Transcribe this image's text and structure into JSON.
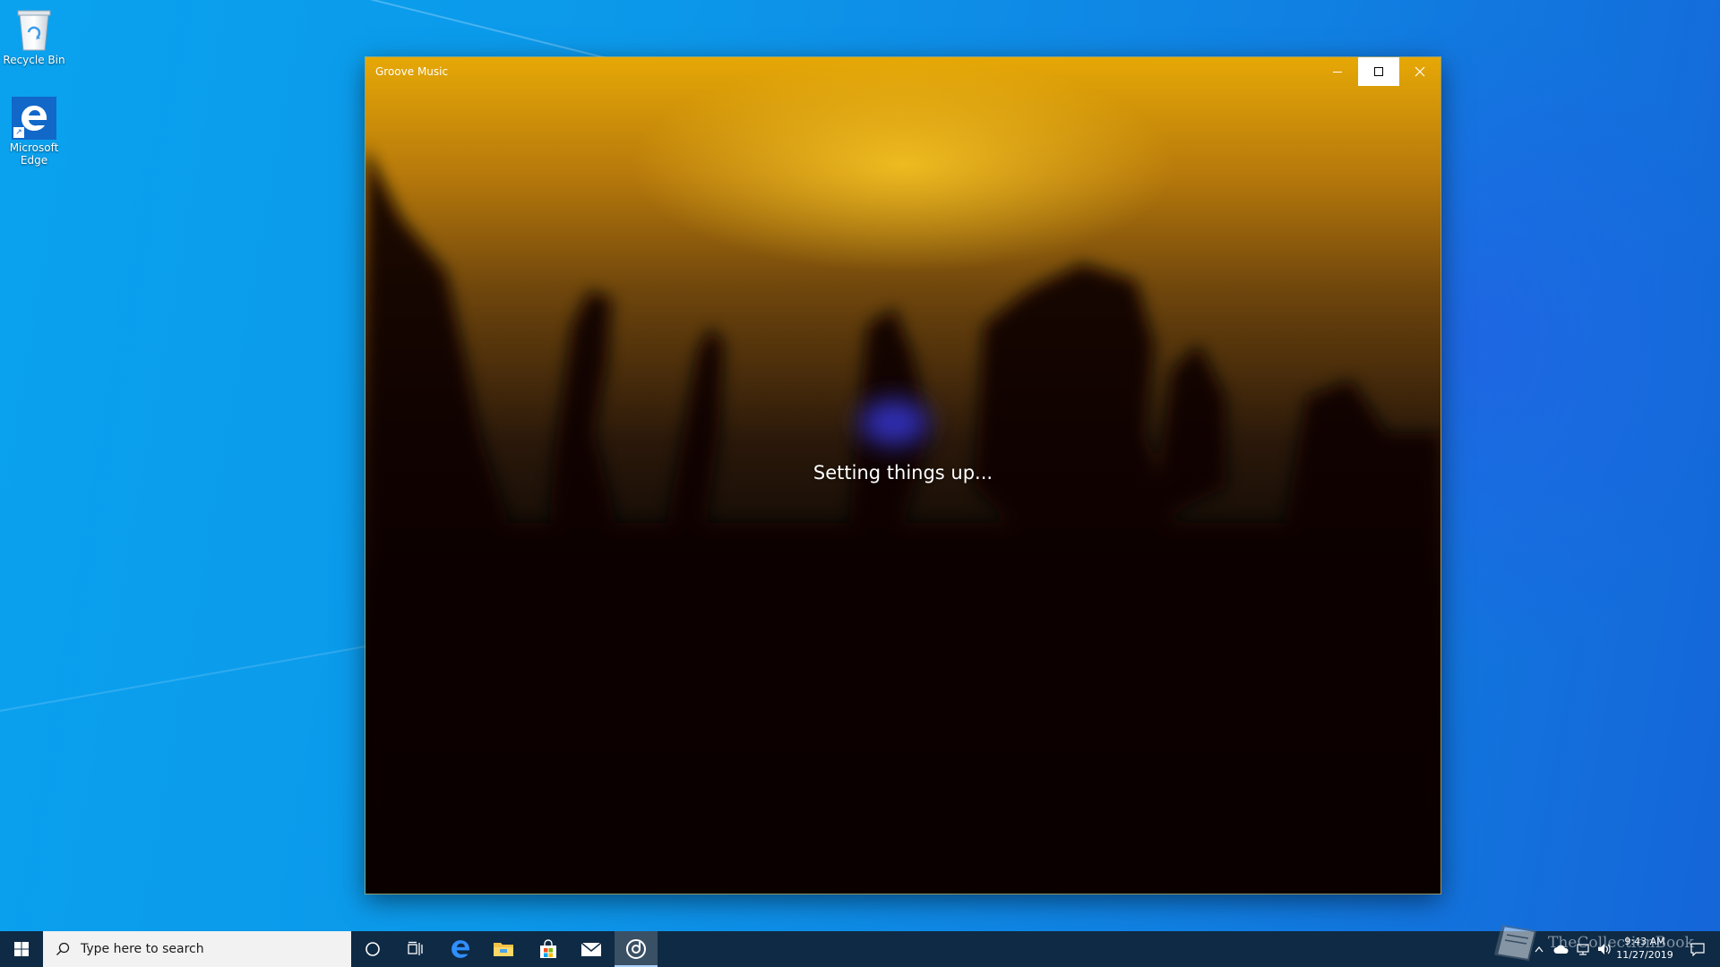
{
  "desktop": {
    "icons": [
      {
        "label": "Recycle Bin",
        "icon": "recycle-bin-icon"
      },
      {
        "label": "Microsoft Edge",
        "icon": "edge-icon"
      }
    ]
  },
  "window": {
    "title": "Groove Music",
    "status_text": "Setting things up...",
    "controls": {
      "minimize": "minimize-icon",
      "maximize": "maximize-icon",
      "close": "close-icon"
    },
    "accent_color": "#e6a806"
  },
  "taskbar": {
    "start_icon": "windows-start-icon",
    "search": {
      "placeholder": "Type here to search",
      "icon": "search-icon"
    },
    "items": [
      {
        "name": "cortana",
        "icon": "cortana-circle-icon"
      },
      {
        "name": "task-view",
        "icon": "task-view-icon"
      },
      {
        "name": "edge",
        "icon": "edge-icon"
      },
      {
        "name": "file-explorer",
        "icon": "folder-icon"
      },
      {
        "name": "store",
        "icon": "store-bag-icon"
      },
      {
        "name": "mail",
        "icon": "mail-envelope-icon"
      },
      {
        "name": "groove-music",
        "icon": "groove-music-icon",
        "active": true
      }
    ],
    "tray": {
      "icons": [
        "chevron-up-icon",
        "onedrive-cloud-icon",
        "network-icon",
        "volume-icon",
        "notification-icon"
      ],
      "time": "9:43 AM",
      "date": "11/27/2019"
    },
    "color": "#0f2a44"
  },
  "watermark": {
    "text": "TheCollectionBook",
    "icon": "book-icon"
  }
}
